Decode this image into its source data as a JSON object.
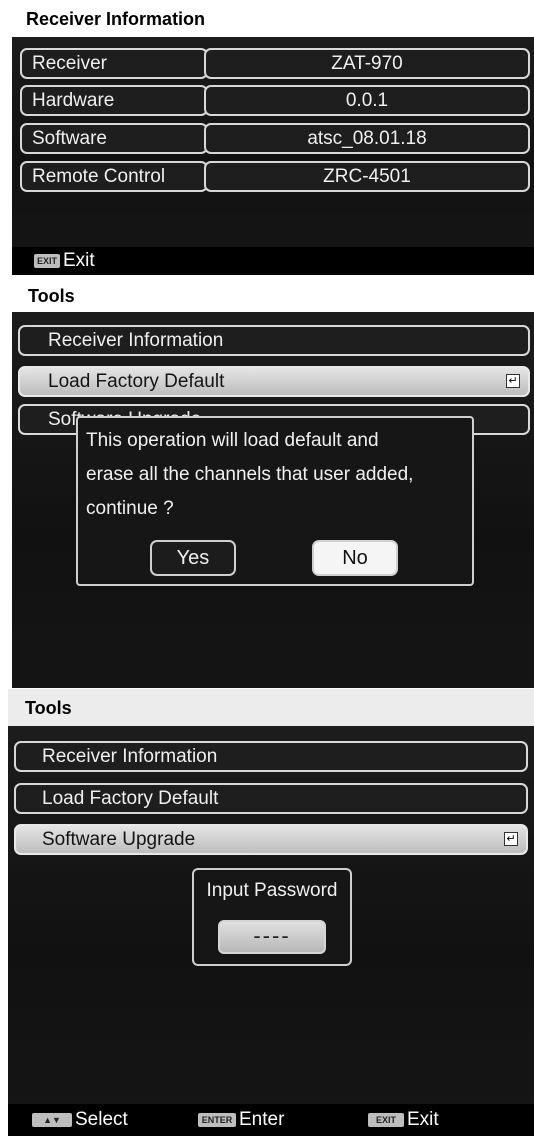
{
  "screen1": {
    "title": "Receiver Information",
    "rows": [
      {
        "label": "Receiver",
        "value": "ZAT-970"
      },
      {
        "label": "Hardware",
        "value": "0.0.1"
      },
      {
        "label": "Software",
        "value": "atsc_08.01.18"
      },
      {
        "label": "Remote Control",
        "value": "ZRC-4501"
      }
    ],
    "footer": {
      "exit_key": "EXIT",
      "exit_label": "Exit"
    }
  },
  "screen2": {
    "title": "Tools",
    "menu": [
      {
        "label": "Receiver Information"
      },
      {
        "label": "Load Factory Default"
      },
      {
        "label": "Software Upgrade"
      }
    ],
    "dialog": {
      "line1": "This operation will load default and",
      "line2": "erase all the channels that user added,",
      "line3": "continue ?",
      "yes_label": "Yes",
      "no_label": "No"
    }
  },
  "screen3": {
    "title": "Tools",
    "menu": [
      {
        "label": "Receiver Information"
      },
      {
        "label": "Load Factory Default"
      },
      {
        "label": "Software Upgrade"
      }
    ],
    "password_dialog": {
      "title": "Input Password",
      "value": "----"
    },
    "footer": {
      "select_key": "▲▼",
      "select_label": "Select",
      "enter_key": "ENTER",
      "enter_label": "Enter",
      "exit_key": "EXIT",
      "exit_label": "Exit"
    }
  },
  "icons": {
    "enter": "enter-return-icon"
  },
  "colors": {
    "panel": "#161616",
    "selected": "#d2d2d2",
    "border": "#d8d8d8"
  }
}
